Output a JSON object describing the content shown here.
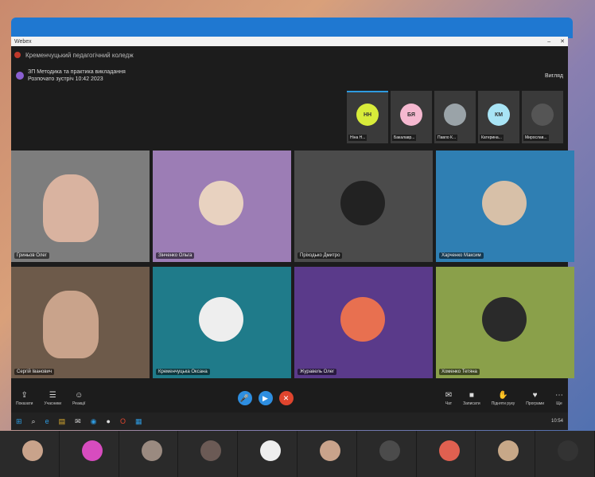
{
  "window": {
    "title": "Webex",
    "controls": [
      "–",
      "✕"
    ],
    "app_title": "Кременчуцький педагогічний коледж"
  },
  "meeting": {
    "name": "ЗП Методика та практика викладання",
    "subtitle": "Розпочато зустріч 10:42 2023",
    "view_button": "Вигляд"
  },
  "thumbnails": [
    {
      "initials": "НН",
      "name": "Ніна Н...",
      "color": "#d8ec3a"
    },
    {
      "initials": "БЯ",
      "name": "Бакалавр...",
      "color": "#f5b8d0"
    },
    {
      "initials": "",
      "name": "Павло К...",
      "color": "#9aa3a8"
    },
    {
      "initials": "КМ",
      "name": "Катерина...",
      "color": "#a8e4f5"
    },
    {
      "initials": "",
      "name": "Мирослав...",
      "color": "#555"
    }
  ],
  "tiles": [
    {
      "name": "Гриньов Олег",
      "bg": "#7d7d7d",
      "face": "#d9b3a0",
      "video": true
    },
    {
      "name": "Зінченко Ольга",
      "bg": "#9c7db5",
      "face": "#e8d2c0",
      "video": false
    },
    {
      "name": "Пріходько Дмитро",
      "bg": "#4b4b4b",
      "face": "#222",
      "video": false
    },
    {
      "name": "Харченко Максим",
      "bg": "#2f7fb3",
      "face": "#d7c0a8",
      "video": false
    },
    {
      "name": "Сергій Іванович",
      "bg": "#6d5a4a",
      "face": "#c9a38b",
      "video": true
    },
    {
      "name": "Кременчуцька Оксана",
      "bg": "#1f7b8a",
      "face": "#eee",
      "video": false
    },
    {
      "name": "Журавель Олег",
      "bg": "#5a3a8a",
      "face": "#e87050",
      "video": false
    },
    {
      "name": "Хоменко Тетяна",
      "bg": "#8aa04a",
      "face": "#2a2a2a",
      "video": false
    }
  ],
  "toolbar": {
    "left": [
      {
        "icon": "share-icon",
        "glyph": "⇪",
        "label": "Показати"
      },
      {
        "icon": "participants-icon",
        "glyph": "☰",
        "label": "Учасники"
      },
      {
        "icon": "reactions-icon",
        "glyph": "☺",
        "label": "Реакції"
      }
    ],
    "right": [
      {
        "icon": "chat-icon",
        "glyph": "✉",
        "label": "Чат"
      },
      {
        "icon": "record-icon",
        "glyph": "■",
        "label": "Записати"
      },
      {
        "icon": "raise-hand-icon",
        "glyph": "✋",
        "label": "Підняти руку"
      },
      {
        "icon": "apps-icon",
        "glyph": "♥",
        "label": "Програми"
      },
      {
        "icon": "more-icon",
        "glyph": "⋯",
        "label": "Ще"
      }
    ],
    "mic": "🎤",
    "camera": "▶",
    "leave": "✕"
  },
  "taskbar": {
    "icons": [
      "⊞",
      "⌕",
      "e",
      "▤",
      "✉",
      "◉",
      "●",
      "O",
      "▦"
    ],
    "clock": "10:54"
  },
  "bottom_strip": [
    {
      "name": "",
      "face": "#c9a38b"
    },
    {
      "name": "",
      "face": "#d74cbf"
    },
    {
      "name": "",
      "face": "#9a8a80"
    },
    {
      "name": "",
      "face": "#6b5a55"
    },
    {
      "name": "",
      "face": "#eee"
    },
    {
      "name": "",
      "face": "#c9a38b"
    },
    {
      "name": "",
      "face": "#4b4b4b"
    },
    {
      "name": "",
      "face": "#e06050"
    },
    {
      "name": "",
      "face": "#c7a888"
    },
    {
      "name": "",
      "face": "#333"
    }
  ]
}
